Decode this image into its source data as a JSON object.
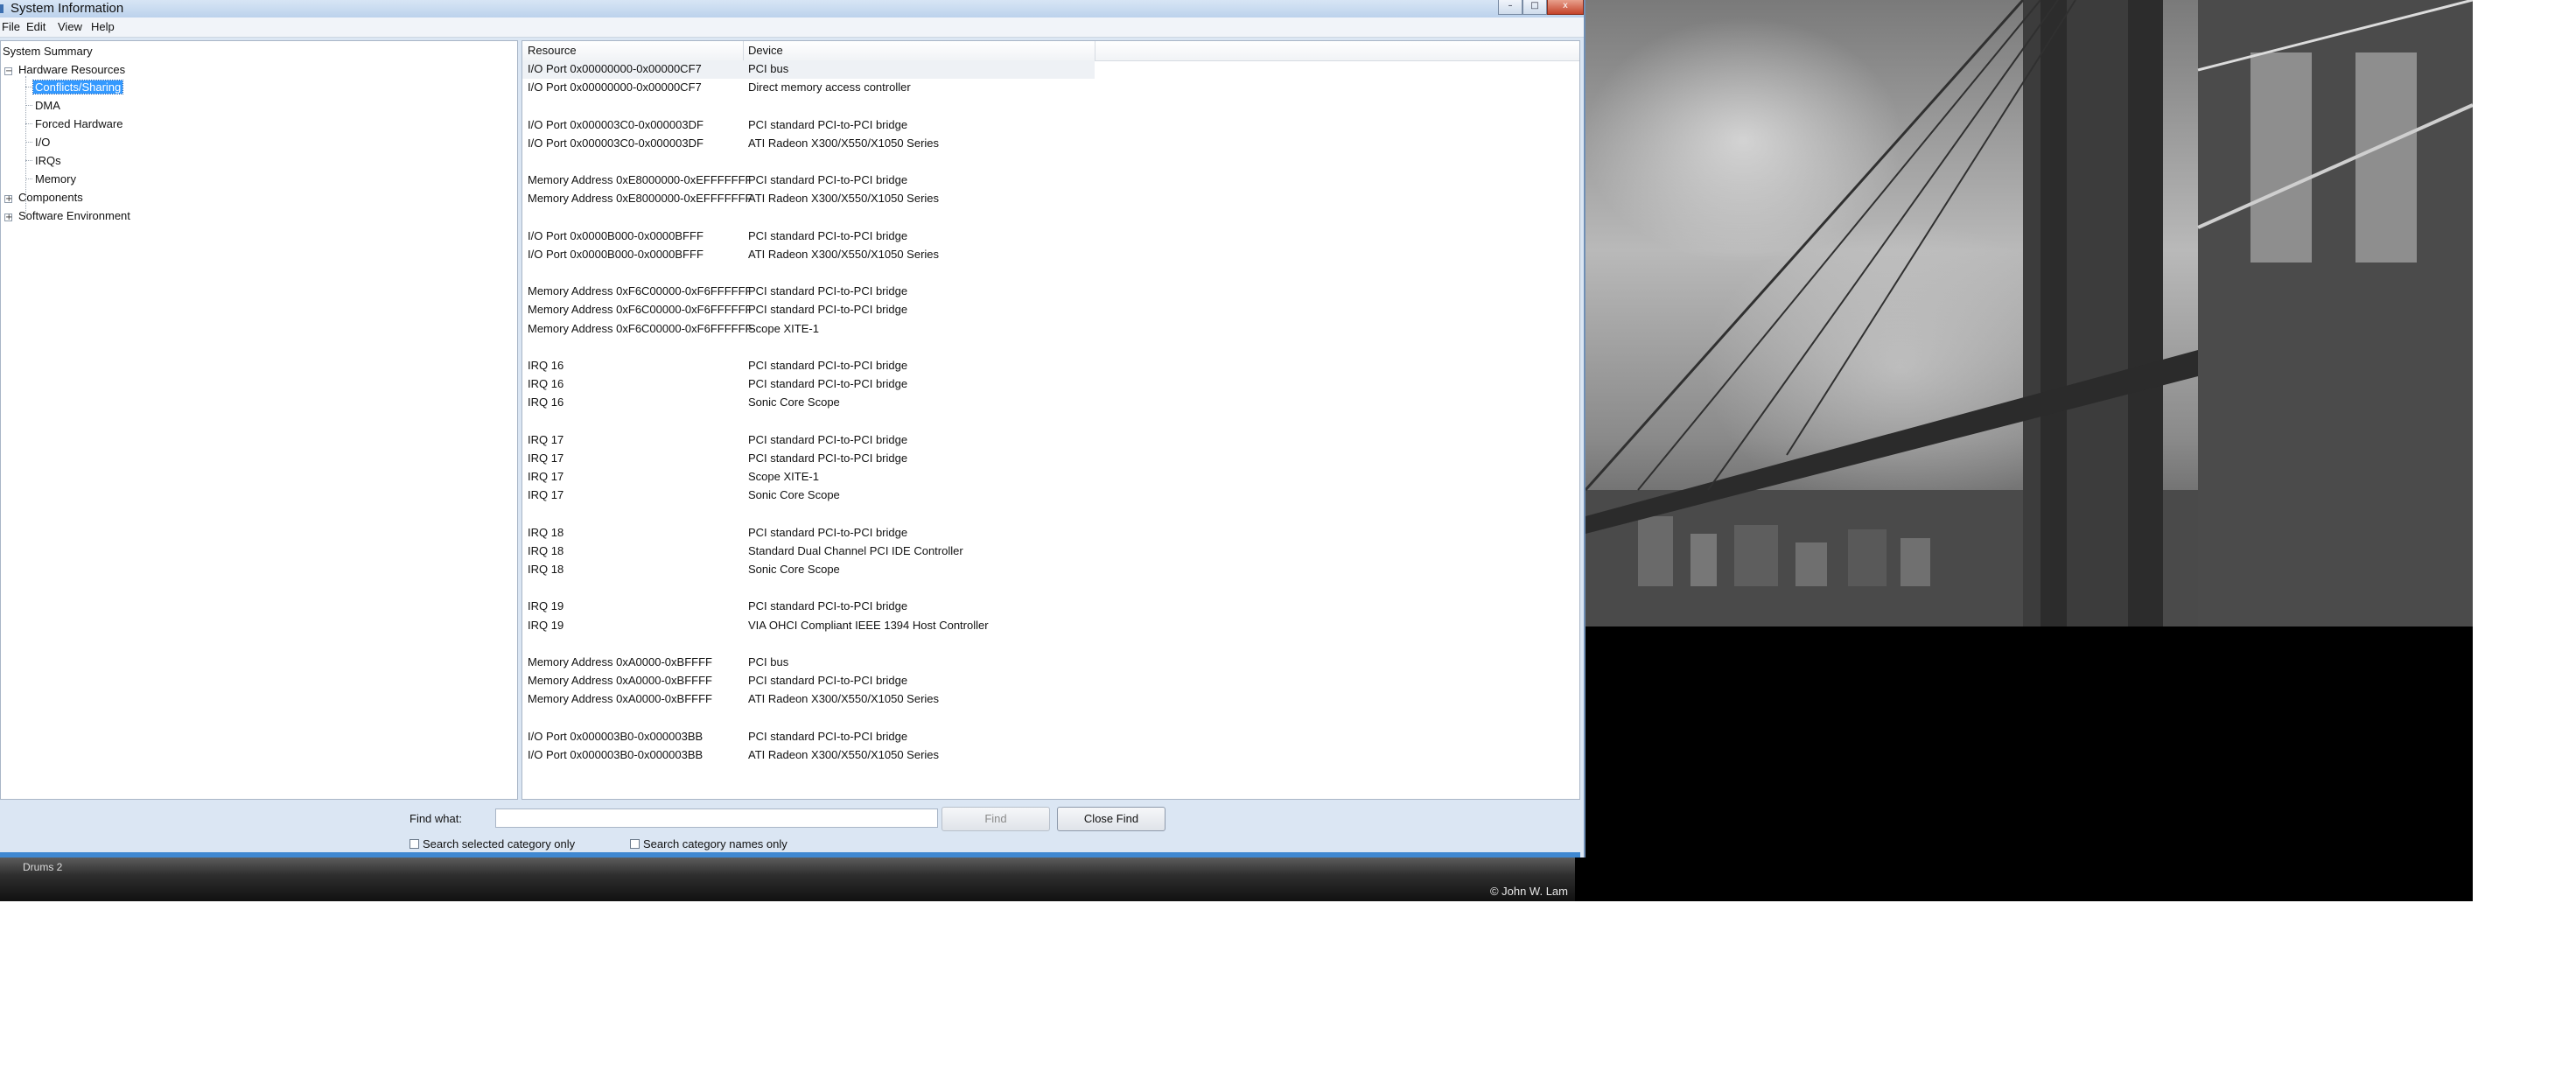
{
  "window": {
    "title": "System Information",
    "menu": [
      "File",
      "Edit",
      "View",
      "Help"
    ],
    "controls": {
      "minimize": "–",
      "maximize": "□",
      "close": "x"
    }
  },
  "tree": {
    "root": "System Summary",
    "hardware_resources": "Hardware Resources",
    "hardware_children": [
      "Conflicts/Sharing",
      "DMA",
      "Forced Hardware",
      "I/O",
      "IRQs",
      "Memory"
    ],
    "selected": "Conflicts/Sharing",
    "components": "Components",
    "software_environment": "Software Environment",
    "expander_expanded": "−",
    "expander_collapsed": "+"
  },
  "list": {
    "columns": [
      "Resource",
      "Device"
    ],
    "rows": [
      [
        "I/O Port 0x00000000-0x00000CF7",
        "PCI bus"
      ],
      [
        "I/O Port 0x00000000-0x00000CF7",
        "Direct memory access controller"
      ],
      [
        "",
        ""
      ],
      [
        "I/O Port 0x000003C0-0x000003DF",
        "PCI standard PCI-to-PCI bridge"
      ],
      [
        "I/O Port 0x000003C0-0x000003DF",
        "ATI Radeon X300/X550/X1050 Series"
      ],
      [
        "",
        ""
      ],
      [
        "Memory Address 0xE8000000-0xEFFFFFFF",
        "PCI standard PCI-to-PCI bridge"
      ],
      [
        "Memory Address 0xE8000000-0xEFFFFFFF",
        "ATI Radeon X300/X550/X1050 Series"
      ],
      [
        "",
        ""
      ],
      [
        "I/O Port 0x0000B000-0x0000BFFF",
        "PCI standard PCI-to-PCI bridge"
      ],
      [
        "I/O Port 0x0000B000-0x0000BFFF",
        "ATI Radeon X300/X550/X1050 Series"
      ],
      [
        "",
        ""
      ],
      [
        "Memory Address 0xF6C00000-0xF6FFFFFF",
        "PCI standard PCI-to-PCI bridge"
      ],
      [
        "Memory Address 0xF6C00000-0xF6FFFFFF",
        "PCI standard PCI-to-PCI bridge"
      ],
      [
        "Memory Address 0xF6C00000-0xF6FFFFFF",
        "Scope XITE-1"
      ],
      [
        "",
        ""
      ],
      [
        "IRQ 16",
        "PCI standard PCI-to-PCI bridge"
      ],
      [
        "IRQ 16",
        "PCI standard PCI-to-PCI bridge"
      ],
      [
        "IRQ 16",
        "Sonic Core Scope"
      ],
      [
        "",
        ""
      ],
      [
        "IRQ 17",
        "PCI standard PCI-to-PCI bridge"
      ],
      [
        "IRQ 17",
        "PCI standard PCI-to-PCI bridge"
      ],
      [
        "IRQ 17",
        "Scope XITE-1"
      ],
      [
        "IRQ 17",
        "Sonic Core Scope"
      ],
      [
        "",
        ""
      ],
      [
        "IRQ 18",
        "PCI standard PCI-to-PCI bridge"
      ],
      [
        "IRQ 18",
        "Standard Dual Channel PCI IDE Controller"
      ],
      [
        "IRQ 18",
        "Sonic Core Scope"
      ],
      [
        "",
        ""
      ],
      [
        "IRQ 19",
        "PCI standard PCI-to-PCI bridge"
      ],
      [
        "IRQ 19",
        "VIA OHCI Compliant IEEE 1394 Host Controller"
      ],
      [
        "",
        ""
      ],
      [
        "Memory Address 0xA0000-0xBFFFF",
        "PCI bus"
      ],
      [
        "Memory Address 0xA0000-0xBFFFF",
        "PCI standard PCI-to-PCI bridge"
      ],
      [
        "Memory Address 0xA0000-0xBFFFF",
        "ATI Radeon X300/X550/X1050 Series"
      ],
      [
        "",
        ""
      ],
      [
        "I/O Port 0x000003B0-0x000003BB",
        "PCI standard PCI-to-PCI bridge"
      ],
      [
        "I/O Port 0x000003B0-0x000003BB",
        "ATI Radeon X300/X550/X1050 Series"
      ]
    ]
  },
  "find": {
    "label": "Find what:",
    "value": "",
    "find_button": "Find",
    "close_button": "Close Find",
    "check_selected": "Search selected category only",
    "check_names": "Search category names only"
  },
  "desktop": {
    "caption": "Drums 2",
    "credit": "© John W. Lam"
  }
}
